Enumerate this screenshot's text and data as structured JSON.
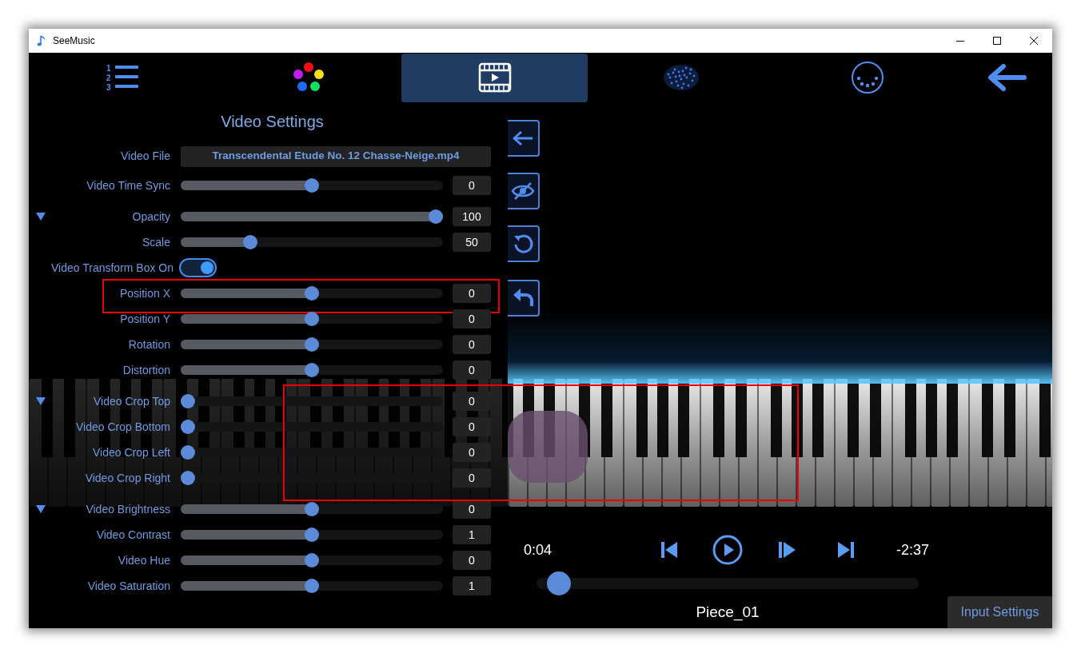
{
  "window": {
    "title": "SeeMusic"
  },
  "nav_tabs": [
    {
      "kind": "list",
      "selected": false,
      "numbers": [
        "1",
        "2",
        "3"
      ]
    },
    {
      "kind": "colors",
      "selected": false
    },
    {
      "kind": "video",
      "selected": true
    },
    {
      "kind": "particles",
      "selected": false
    },
    {
      "kind": "midi",
      "selected": false
    },
    {
      "kind": "back",
      "selected": false
    }
  ],
  "settings": {
    "title": "Video Settings",
    "rows": [
      {
        "kind": "file",
        "label": "Video File",
        "value": "Transcendental Etude No. 12 Chasse-Neige.mp4"
      },
      {
        "kind": "slider",
        "label": "Video Time Sync",
        "level": 0.5,
        "value": "0"
      },
      {
        "kind": "slider",
        "label": "Opacity",
        "expanded": true,
        "level": 1,
        "value": "100"
      },
      {
        "kind": "slider",
        "label": "Scale",
        "level": 0.25,
        "value": "50"
      },
      {
        "kind": "toggle",
        "label": "Video Transform Box On",
        "on": true
      },
      {
        "kind": "slider",
        "label": "Position X",
        "level": 0.5,
        "value": "0",
        "highlighted": true
      },
      {
        "kind": "slider",
        "label": "Position Y",
        "level": 0.5,
        "value": "0"
      },
      {
        "kind": "slider",
        "label": "Rotation",
        "level": 0.5,
        "value": "0"
      },
      {
        "kind": "slider",
        "label": "Distortion",
        "level": 0.5,
        "value": "0"
      },
      {
        "kind": "slider",
        "label": "Video Crop Top",
        "expanded": true,
        "level": 0,
        "value": "0"
      },
      {
        "kind": "slider",
        "label": "Video Crop Bottom",
        "level": 0,
        "value": "0"
      },
      {
        "kind": "slider",
        "label": "Video Crop Left",
        "level": 0,
        "value": "0"
      },
      {
        "kind": "slider",
        "label": "Video Crop Right",
        "level": 0,
        "value": "0"
      },
      {
        "kind": "slider",
        "label": "Video Brightness",
        "expanded": true,
        "level": 0.5,
        "value": "0"
      },
      {
        "kind": "slider",
        "label": "Video Contrast",
        "level": 0.5,
        "value": "1"
      },
      {
        "kind": "slider",
        "label": "Video Hue",
        "level": 0.5,
        "value": "0"
      },
      {
        "kind": "slider",
        "label": "Video Saturation",
        "level": 0.5,
        "value": "1"
      }
    ]
  },
  "side_buttons": [
    {
      "kind": "back"
    },
    {
      "kind": "hide"
    },
    {
      "kind": "reset"
    },
    {
      "kind": "undo"
    }
  ],
  "video": {
    "highlighted": true
  },
  "player": {
    "elapsed": "0:04",
    "remaining": "-2:37",
    "level": 0.03,
    "title": "Piece_01",
    "controls": [
      {
        "kind": "previous"
      },
      {
        "kind": "play"
      },
      {
        "kind": "step"
      },
      {
        "kind": "next"
      }
    ]
  },
  "input_settings_button": "Input Settings"
}
